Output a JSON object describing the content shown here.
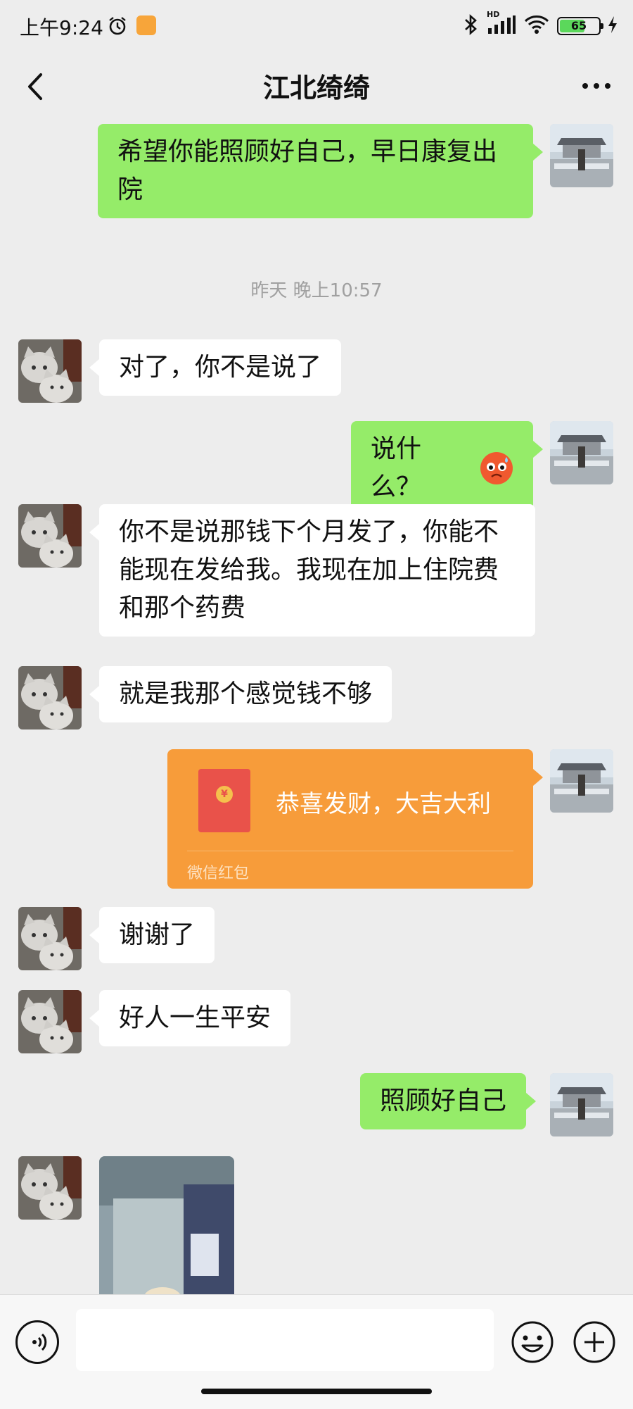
{
  "status_bar": {
    "time": "上午9:24",
    "battery": "65",
    "battery_level": 0.65,
    "network_label": "HD"
  },
  "header": {
    "title": "江北绮绮",
    "back_icon": "chevron-left-icon",
    "more_icon": "more-dots-icon"
  },
  "messages": [
    {
      "side": "right",
      "type": "text",
      "text": "希望你能照顾好自己，早日康复出院"
    },
    {
      "type": "timestamp",
      "text": "昨天 晚上10:57"
    },
    {
      "side": "left",
      "type": "text",
      "text": "对了，你不是说了"
    },
    {
      "side": "right",
      "type": "text",
      "text": "说什么？",
      "emoji": "worried-face-emoji"
    },
    {
      "side": "left",
      "type": "text",
      "text": "你不是说那钱下个月发了，你能不能现在发给我。我现在加上住院费和那个药费"
    },
    {
      "side": "left",
      "type": "text",
      "text": "就是我那个感觉钱不够"
    },
    {
      "side": "right",
      "type": "red_packet",
      "greeting": "恭喜发财，大吉大利",
      "footer": "微信红包"
    },
    {
      "side": "left",
      "type": "text",
      "text": "谢谢了"
    },
    {
      "side": "left",
      "type": "text",
      "text": "好人一生平安"
    },
    {
      "side": "right",
      "type": "text",
      "text": "照顾好自己"
    },
    {
      "side": "left",
      "type": "image"
    }
  ],
  "input_bar": {
    "voice_icon": "voice-icon",
    "input_value": "",
    "emoji_icon": "emoji-icon",
    "plus_icon": "plus-icon"
  },
  "colors": {
    "background": "#ededed",
    "sent_bubble": "#95ec69",
    "received_bubble": "#ffffff",
    "red_packet": "#f79c3a"
  }
}
